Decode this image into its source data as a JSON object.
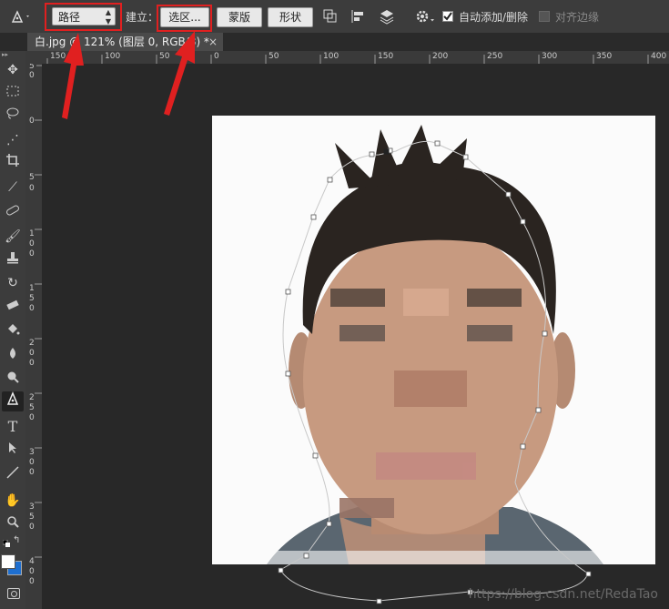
{
  "options_bar": {
    "mode_select": "路径",
    "make_label": "建立：",
    "selection_btn": "选区...",
    "mask_btn": "蒙版",
    "shape_btn": "形状",
    "auto_add_delete": "自动添加/删除",
    "auto_add_checked": true,
    "align_edges": "对齐边缘",
    "align_checked": false
  },
  "document_tab": {
    "title": "白.jpg @ 121% (图层 0, RGB/8) *",
    "close": "×"
  },
  "ruler": {
    "h_labels": [
      "150",
      "100",
      "50",
      "0",
      "50",
      "100",
      "150",
      "200",
      "250",
      "300",
      "350",
      "400"
    ],
    "v_labels": [
      "5",
      "0",
      "0",
      "5",
      "0",
      "1 0 0",
      "1 5 0",
      "2 0 0",
      "2 5 0",
      "3 0 0",
      "3 5 0",
      "4 0 0"
    ]
  },
  "watermark": "https://blog.csdn.net/RedaTao",
  "colors": {
    "annotation": "#e02020",
    "panel": "#3c3c3c",
    "canvas_bg": "#282828"
  },
  "tools": [
    "move-icon",
    "marquee-icon",
    "lasso-icon",
    "magic-wand-icon",
    "crop-icon",
    "eyedropper-icon",
    "healing-icon",
    "brush-icon",
    "stamp-icon",
    "history-brush-icon",
    "eraser-icon",
    "paint-bucket-icon",
    "blur-icon",
    "dodge-icon",
    "pen-icon",
    "type-icon",
    "path-select-icon",
    "line-icon",
    "hand-icon",
    "zoom-icon"
  ]
}
